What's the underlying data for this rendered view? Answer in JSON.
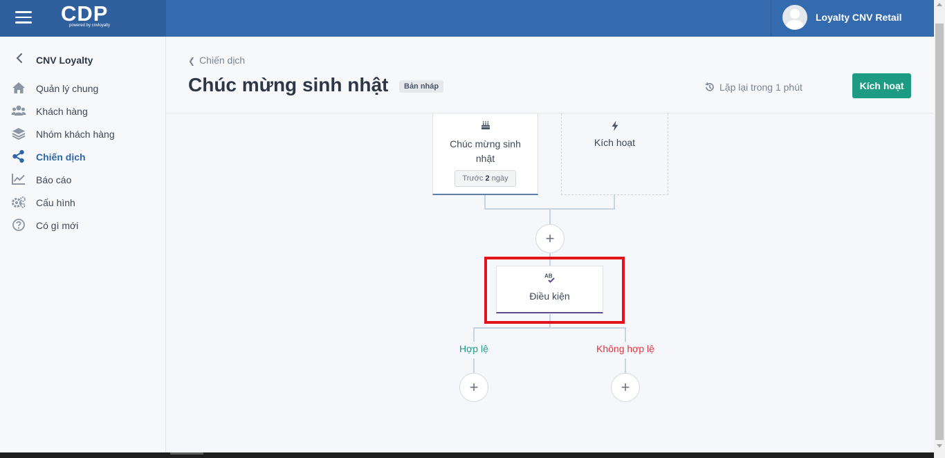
{
  "app": {
    "logo": "CDP",
    "logo_sub": "powered by cnvloyalty"
  },
  "user": {
    "name": "Loyalty CNV Retail"
  },
  "sidebar": {
    "title": "CNV Loyalty",
    "items": [
      {
        "label": "Quản lý chung",
        "icon": "home-icon"
      },
      {
        "label": "Khách hàng",
        "icon": "users-icon"
      },
      {
        "label": "Nhóm khách hàng",
        "icon": "layers-icon"
      },
      {
        "label": "Chiến dịch",
        "icon": "share-icon",
        "active": true
      },
      {
        "label": "Báo cáo",
        "icon": "chart-line-icon"
      },
      {
        "label": "Cấu hình",
        "icon": "gears-icon"
      },
      {
        "label": "Có gì mới",
        "icon": "question-circle-icon"
      }
    ]
  },
  "header": {
    "breadcrumb": "Chiến dịch",
    "title": "Chúc mừng sinh nhật",
    "status_badge": "Bản nháp",
    "repeat_text": "Lặp lại trong 1 phút",
    "activate_button": "Kích hoạt"
  },
  "flow": {
    "trigger": {
      "title": "Chúc mừng sinh nhật",
      "pill_prefix": "Trước",
      "pill_value": "2",
      "pill_suffix": "ngày",
      "icon": "birthday-cake-icon"
    },
    "event": {
      "title": "Kích hoạt",
      "icon": "lightning-icon"
    },
    "condition": {
      "title": "Điều kiện",
      "icon": "spell-check-icon"
    },
    "branch_yes": "Hợp lệ",
    "branch_no": "Không hợp lệ",
    "add_symbol": "+"
  },
  "colors": {
    "topbar": "#346aae",
    "accent": "#2f66a8",
    "activate": "#1d9c83",
    "valid": "#1d9c83",
    "invalid": "#e0343e",
    "highlight": "#e3131c"
  }
}
